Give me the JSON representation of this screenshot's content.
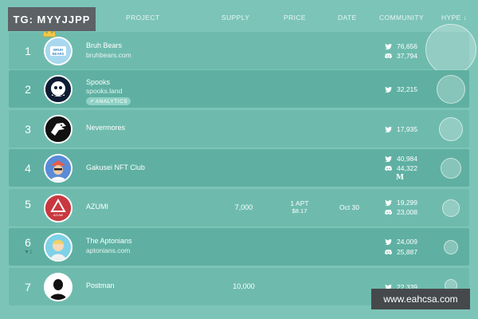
{
  "badge": "TG: MYYJJPP",
  "header": {
    "project": "PROJECT",
    "supply": "SUPPLY",
    "price": "PRICE",
    "date": "DATE",
    "community": "COMMUNITY",
    "hype": "HYPE ↓"
  },
  "rows": [
    {
      "rank": "1",
      "name": "Bruh Bears",
      "sub": "bruhbears.com",
      "twitter": "76,656",
      "discord": "37,794"
    },
    {
      "rank": "2",
      "name": "Spooks",
      "sub": "spooks.land",
      "tag": "ANALYTICS",
      "twitter": "32,215"
    },
    {
      "rank": "3",
      "name": "Nevermores",
      "twitter": "17,935"
    },
    {
      "rank": "4",
      "name": "Gakusei NFT Club",
      "twitter": "40,984",
      "discord": "44,322",
      "medium": "M"
    },
    {
      "rank": "5",
      "name": "AZUMI",
      "supply": "7,000",
      "price": "1 APT",
      "price_usd": "$8.17",
      "date": "Oct 30",
      "twitter": "19,299",
      "discord": "23,008"
    },
    {
      "rank": "6",
      "rank_sub": "▼1",
      "name": "The Aptonians",
      "sub": "aptonians.com",
      "twitter": "24,009",
      "discord": "25,887"
    },
    {
      "rank": "7",
      "name": "Postman",
      "supply": "10,000",
      "twitter": "22,339"
    }
  ],
  "avatar_texts": {
    "bruh": "BRUH\nBEARS",
    "azumi": "AZUMI"
  },
  "watermark": "www.eahcsa.com",
  "colors": {
    "background": "#7cc4b8",
    "row": "#6ebbae",
    "row_dark": "#5fb0a2",
    "badge": "#5c6266"
  }
}
